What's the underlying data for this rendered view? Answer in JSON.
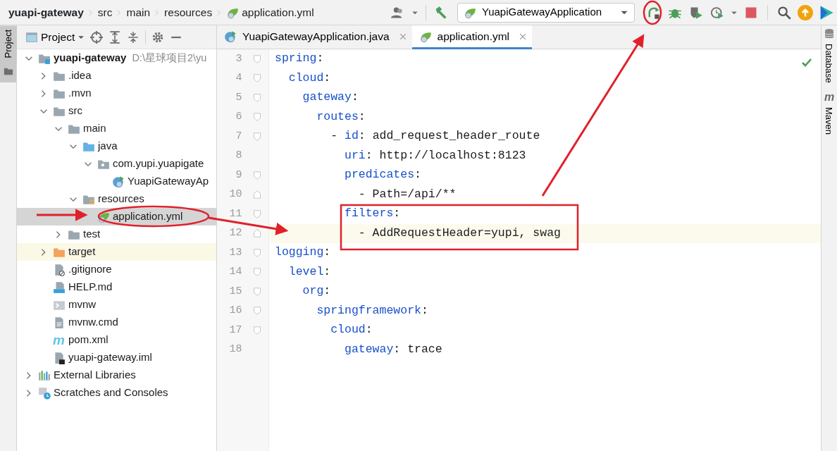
{
  "breadcrumbs": [
    {
      "label": "yuapi-gateway",
      "kind": "project"
    },
    {
      "label": "src",
      "kind": "folder"
    },
    {
      "label": "main",
      "kind": "folder"
    },
    {
      "label": "resources",
      "kind": "folder"
    },
    {
      "label": "application.yml",
      "kind": "yaml"
    }
  ],
  "run_configuration": {
    "label": "YuapiGatewayApplication"
  },
  "left_tool_tabs": [
    {
      "label": "Project",
      "selected": true
    }
  ],
  "project_panel": {
    "view": "Project"
  },
  "tree": [
    {
      "label": "yuapi-gateway",
      "hint": "D:\\星球项目2\\yu",
      "kind": "module",
      "expanded": true,
      "selected": false,
      "children": [
        {
          "label": ".idea",
          "kind": "folder",
          "expanded": false,
          "selected": false
        },
        {
          "label": ".mvn",
          "kind": "folder",
          "expanded": false,
          "selected": false
        },
        {
          "label": "src",
          "kind": "folder",
          "expanded": true,
          "selected": false,
          "children": [
            {
              "label": "main",
              "kind": "folder",
              "expanded": true,
              "selected": false,
              "children": [
                {
                  "label": "java",
                  "kind": "source",
                  "expanded": true,
                  "selected": false,
                  "children": [
                    {
                      "label": "com.yupi.yuapigate",
                      "kind": "package",
                      "expanded": true,
                      "selected": false,
                      "children": [
                        {
                          "label": "YuapiGatewayAp",
                          "kind": "class",
                          "selected": false
                        }
                      ]
                    }
                  ]
                },
                {
                  "label": "resources",
                  "kind": "resources",
                  "expanded": true,
                  "selected": false,
                  "children": [
                    {
                      "label": "application.yml",
                      "kind": "yaml",
                      "selected": true
                    }
                  ]
                }
              ]
            },
            {
              "label": "test",
              "kind": "folder",
              "expanded": false,
              "selected": false
            }
          ]
        },
        {
          "label": "target",
          "kind": "excluded",
          "expanded": false,
          "selected": false,
          "highlighted": true
        },
        {
          "label": ".gitignore",
          "kind": "ignore",
          "selected": false
        },
        {
          "label": "HELP.md",
          "kind": "markdown",
          "selected": false
        },
        {
          "label": "mvnw",
          "kind": "shell",
          "selected": false
        },
        {
          "label": "mvnw.cmd",
          "kind": "text",
          "selected": false
        },
        {
          "label": "pom.xml",
          "kind": "maven",
          "glyph": "m",
          "selected": false
        },
        {
          "label": "yuapi-gateway.iml",
          "kind": "iml",
          "selected": false
        }
      ]
    },
    {
      "label": "External Libraries",
      "kind": "libraries",
      "expanded": false,
      "selected": false
    },
    {
      "label": "Scratches and Consoles",
      "kind": "scratches",
      "expanded": false,
      "selected": false
    }
  ],
  "editor_tabs": [
    {
      "label": "YuapiGatewayApplication.java",
      "kind": "class",
      "selected": false
    },
    {
      "label": "application.yml",
      "kind": "yaml",
      "selected": true
    }
  ],
  "code_lines": [
    {
      "number": "3",
      "foldable": true,
      "fold_end": false,
      "current": false,
      "tokens": [
        {
          "kind": "key",
          "text": "spring"
        },
        {
          "kind": "plain",
          "text": ":"
        }
      ]
    },
    {
      "number": "4",
      "foldable": true,
      "fold_end": false,
      "current": false,
      "tokens": [
        {
          "kind": "key",
          "text": "  cloud"
        },
        {
          "kind": "plain",
          "text": ":"
        }
      ]
    },
    {
      "number": "5",
      "foldable": true,
      "fold_end": false,
      "current": false,
      "tokens": [
        {
          "kind": "key",
          "text": "    gateway"
        },
        {
          "kind": "plain",
          "text": ":"
        }
      ]
    },
    {
      "number": "6",
      "foldable": true,
      "fold_end": false,
      "current": false,
      "tokens": [
        {
          "kind": "key",
          "text": "      routes"
        },
        {
          "kind": "plain",
          "text": ":"
        }
      ]
    },
    {
      "number": "7",
      "foldable": true,
      "fold_end": false,
      "current": false,
      "tokens": [
        {
          "kind": "plain",
          "text": "        - "
        },
        {
          "kind": "key",
          "text": "id"
        },
        {
          "kind": "plain",
          "text": ": add_request_header_route"
        }
      ]
    },
    {
      "number": "8",
      "foldable": false,
      "fold_end": false,
      "current": false,
      "tokens": [
        {
          "kind": "key",
          "text": "          uri"
        },
        {
          "kind": "plain",
          "text": ": http://localhost:8123"
        }
      ]
    },
    {
      "number": "9",
      "foldable": true,
      "fold_end": false,
      "current": false,
      "tokens": [
        {
          "kind": "key",
          "text": "          predicates"
        },
        {
          "kind": "plain",
          "text": ":"
        }
      ]
    },
    {
      "number": "10",
      "foldable": false,
      "fold_end": true,
      "current": false,
      "tokens": [
        {
          "kind": "plain",
          "text": "            - Path=/api/**"
        }
      ]
    },
    {
      "number": "11",
      "foldable": true,
      "fold_end": false,
      "current": false,
      "tokens": [
        {
          "kind": "key",
          "text": "          filters"
        },
        {
          "kind": "plain",
          "text": ":"
        }
      ]
    },
    {
      "number": "12",
      "foldable": false,
      "fold_end": true,
      "current": true,
      "tokens": [
        {
          "kind": "plain",
          "text": "            - AddRequestHeader=yupi, swag"
        }
      ]
    },
    {
      "number": "13",
      "foldable": true,
      "fold_end": false,
      "current": false,
      "tokens": [
        {
          "kind": "key",
          "text": "logging"
        },
        {
          "kind": "plain",
          "text": ":"
        }
      ]
    },
    {
      "number": "14",
      "foldable": true,
      "fold_end": false,
      "current": false,
      "tokens": [
        {
          "kind": "key",
          "text": "  level"
        },
        {
          "kind": "plain",
          "text": ":"
        }
      ]
    },
    {
      "number": "15",
      "foldable": true,
      "fold_end": false,
      "current": false,
      "tokens": [
        {
          "kind": "key",
          "text": "    org"
        },
        {
          "kind": "plain",
          "text": ":"
        }
      ]
    },
    {
      "number": "16",
      "foldable": true,
      "fold_end": false,
      "current": false,
      "tokens": [
        {
          "kind": "key",
          "text": "      springframework"
        },
        {
          "kind": "plain",
          "text": ":"
        }
      ]
    },
    {
      "number": "17",
      "foldable": true,
      "fold_end": false,
      "current": false,
      "tokens": [
        {
          "kind": "key",
          "text": "        cloud"
        },
        {
          "kind": "plain",
          "text": ":"
        }
      ]
    },
    {
      "number": "18",
      "foldable": false,
      "fold_end": false,
      "current": false,
      "tokens": [
        {
          "kind": "key",
          "text": "          gateway"
        },
        {
          "kind": "plain",
          "text": ": trace"
        }
      ]
    }
  ],
  "right_tool_tabs": [
    {
      "label": "Database",
      "kind": "database"
    },
    {
      "label": "Maven",
      "kind": "maven",
      "glyph": "m"
    }
  ]
}
